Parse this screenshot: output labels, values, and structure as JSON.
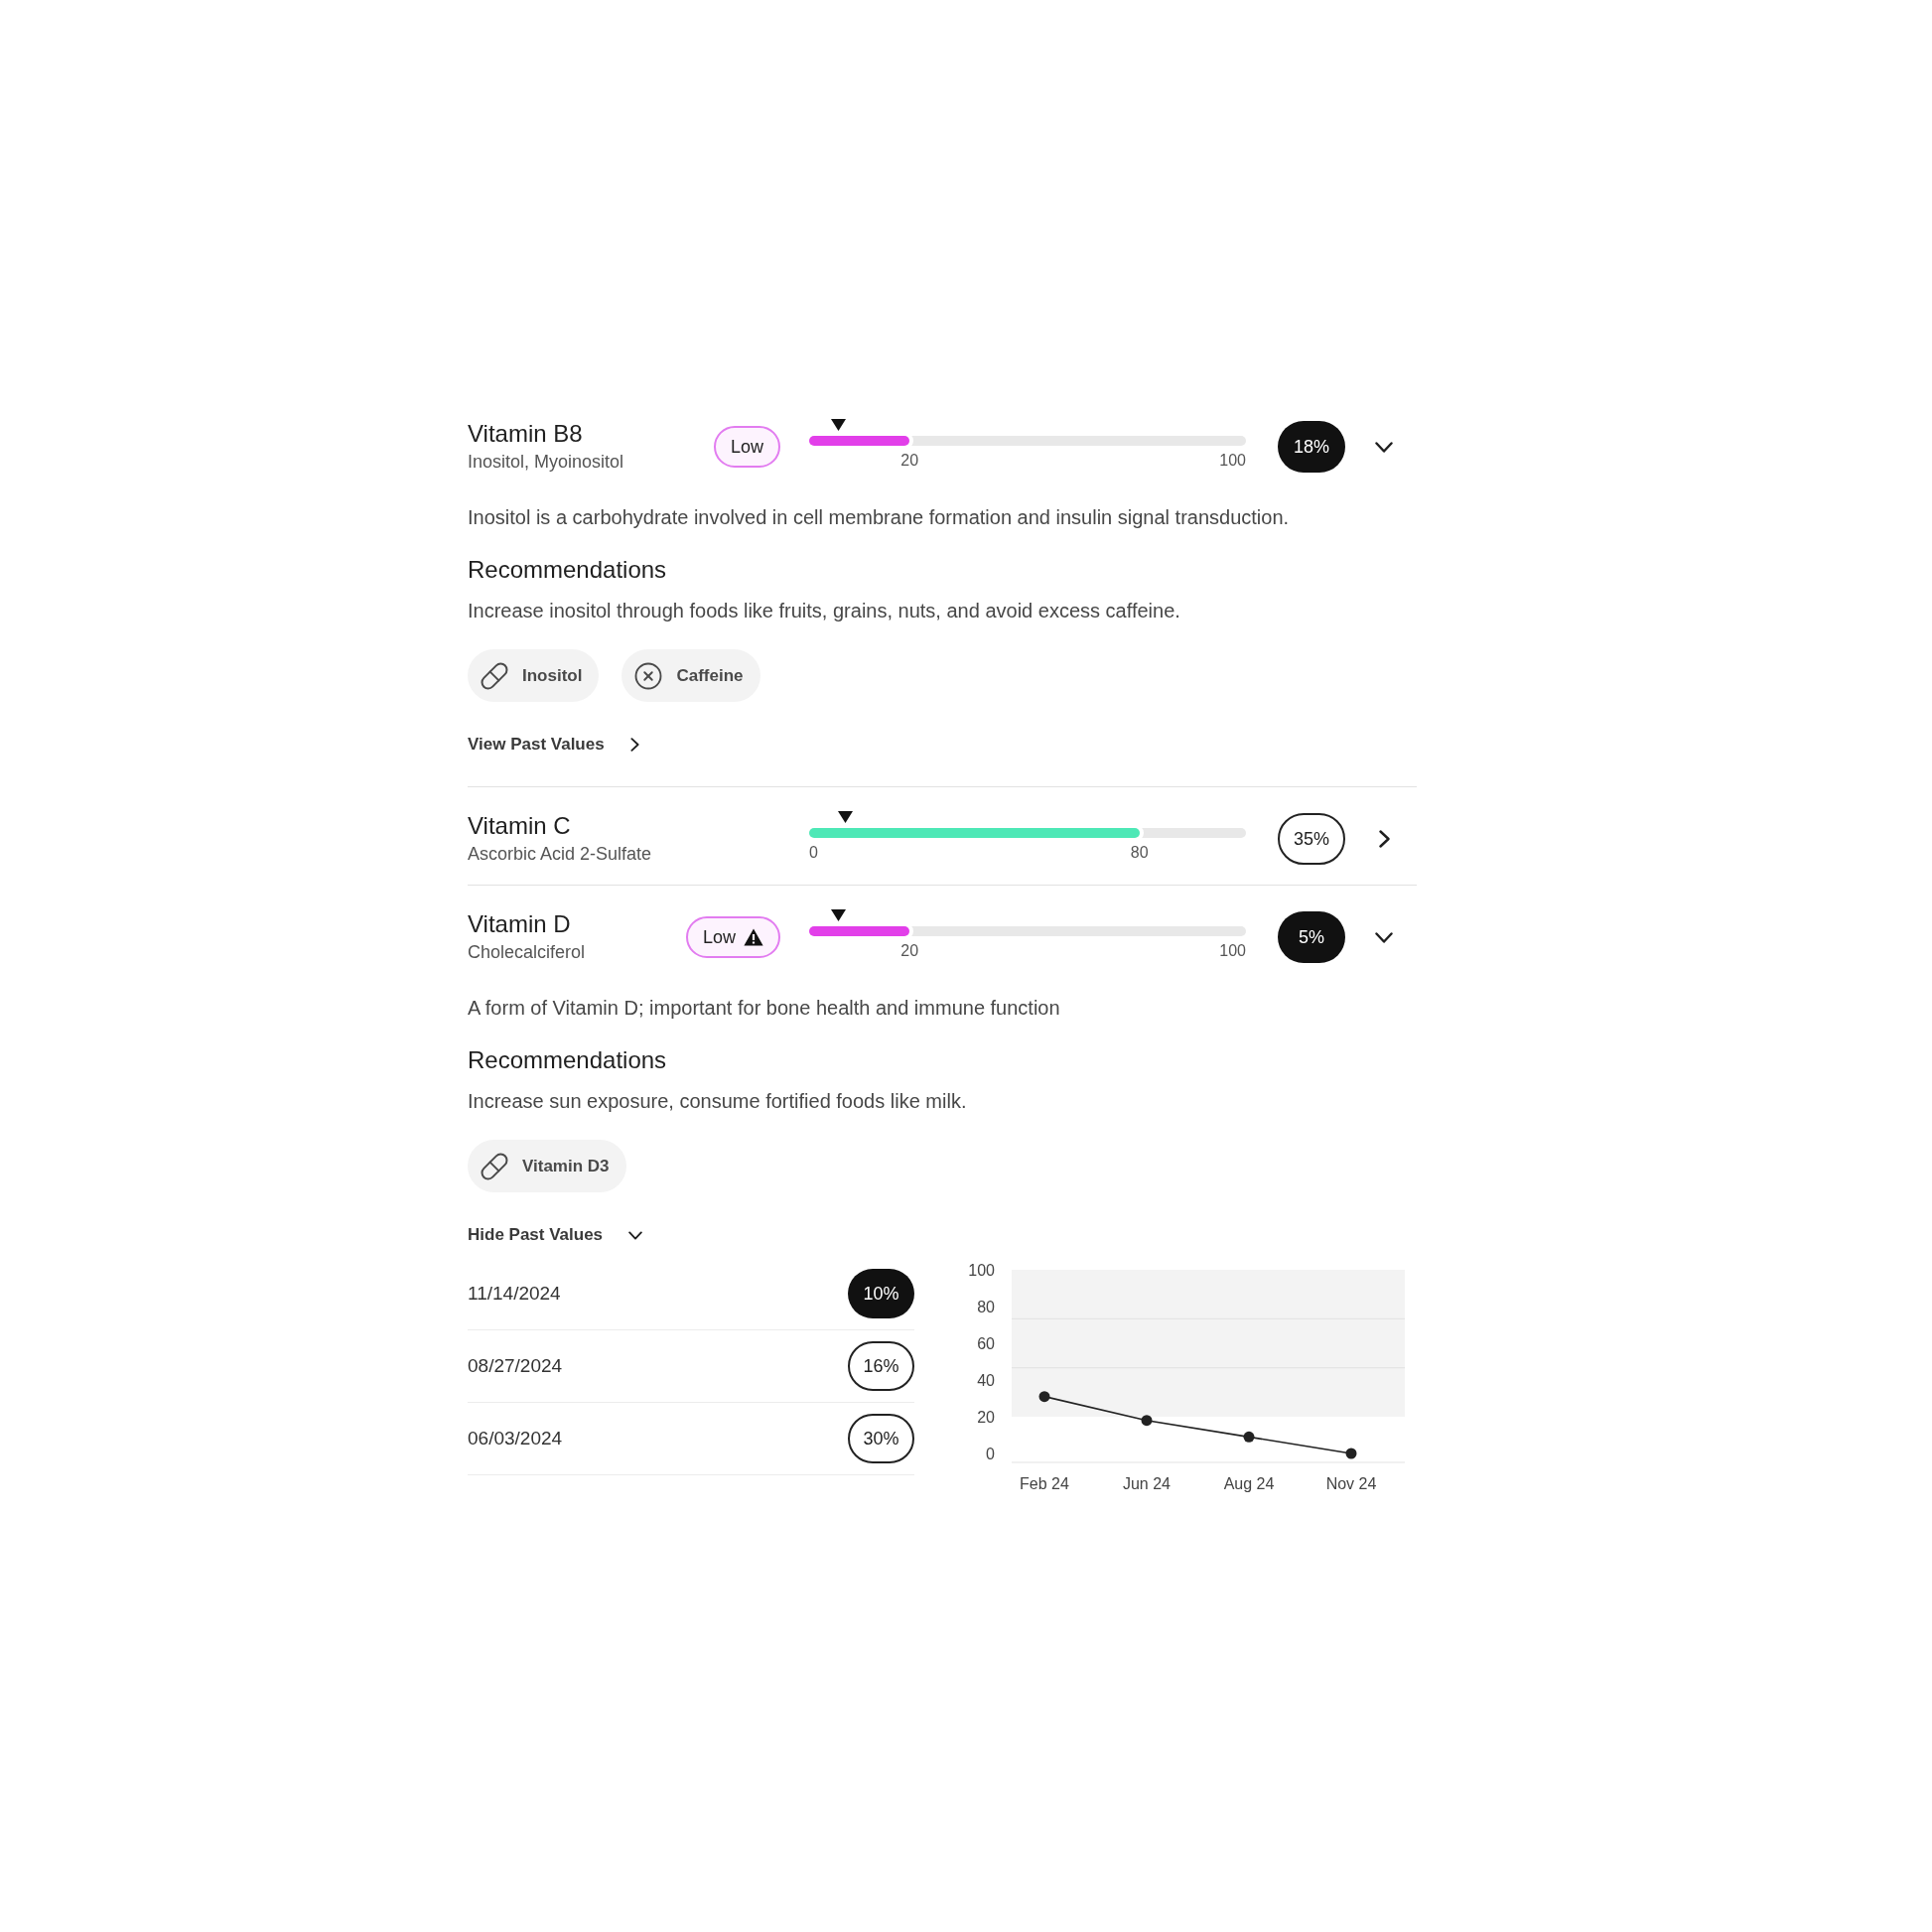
{
  "biomarkers": [
    {
      "name": "Vitamin B8",
      "subtitle": "Inositol, Myoinositol",
      "badge": {
        "label": "Low",
        "warning": false
      },
      "meter": {
        "fill": {
          "level": 0.23,
          "color": "#e23fe9"
        },
        "marker": {
          "level": 0.068
        },
        "split_label": "20",
        "end_label": "100"
      },
      "score": {
        "label": "18%",
        "filled": true
      },
      "expanded": true,
      "details": {
        "description": "Inositol is a carbohydrate involved in cell membrane formation and insulin signal transduction.",
        "recommendations_title": "Recommendations",
        "recommendations": "Increase inositol through foods like fruits, grains, nuts, and avoid excess caffeine.",
        "chips": [
          {
            "kind": "supplement",
            "label": "Inositol"
          },
          {
            "kind": "avoid",
            "label": "Caffeine"
          }
        ],
        "past_values": {
          "label": "View Past Values",
          "expanded": false
        }
      }
    },
    {
      "name": "Vitamin C",
      "subtitle": "Ascorbic Acid 2-Sulfate",
      "meter": {
        "fill": {
          "level": 0.756,
          "color": "#4de8b6"
        },
        "marker": {
          "level": 0.082
        },
        "start_label": "0",
        "split_label": "80"
      },
      "score": {
        "label": "35%",
        "filled": false
      },
      "expanded": false
    },
    {
      "name": "Vitamin D",
      "subtitle": "Cholecalciferol",
      "badge": {
        "label": "Low",
        "warning": true
      },
      "meter": {
        "fill": {
          "level": 0.23,
          "color": "#e23fe9"
        },
        "marker": {
          "level": 0.068
        },
        "split_label": "20",
        "end_label": "100"
      },
      "score": {
        "label": "5%",
        "filled": true
      },
      "expanded": true,
      "details": {
        "description": "A form of Vitamin D; important for bone health and immune function",
        "recommendations_title": "Recommendations",
        "recommendations": "Increase sun exposure, consume fortified foods like milk.",
        "chips": [
          {
            "kind": "supplement",
            "label": "Vitamin D3"
          }
        ],
        "past_values": {
          "label": "Hide Past Values",
          "expanded": true,
          "history": [
            {
              "date": "11/14/2024",
              "value": "10%",
              "filled": true
            },
            {
              "date": "08/27/2024",
              "value": "16%",
              "filled": false
            },
            {
              "date": "06/03/2024",
              "value": "30%",
              "filled": false
            }
          ],
          "chart_data": {
            "type": "line",
            "categories": [
              "Feb 24",
              "Jun 24",
              "Aug 24",
              "Nov 24"
            ],
            "series": [
              {
                "color": "#222222",
                "marker": "circle",
                "values": [
                  31,
                  18,
                  9,
                  0
                ]
              }
            ],
            "ylim": [
              0,
              100
            ],
            "yticks": [
              {
                "value": 0,
                "label": "0"
              },
              {
                "value": 20,
                "label": "20"
              },
              {
                "value": 40,
                "label": "40"
              },
              {
                "value": 60,
                "label": "60"
              },
              {
                "value": 80,
                "label": "80"
              },
              {
                "value": 100,
                "label": "100"
              }
            ],
            "bands": [
              {
                "axis": "y",
                "from": 20,
                "to": 100
              }
            ],
            "ref_lines": [
              {
                "axis": "y",
                "value": 73.3
              },
              {
                "axis": "y",
                "value": 46.7
              }
            ]
          }
        }
      }
    }
  ]
}
